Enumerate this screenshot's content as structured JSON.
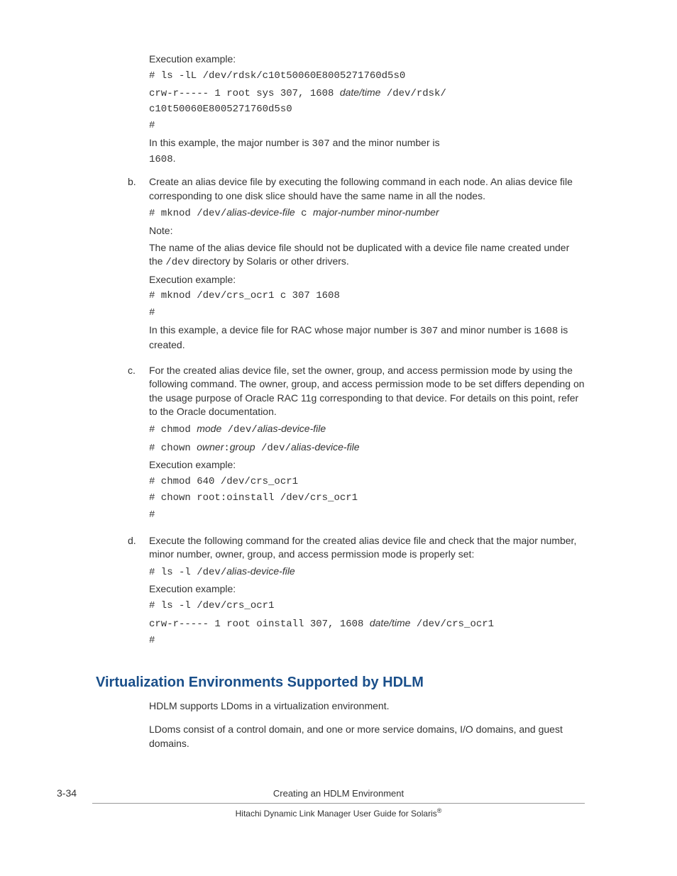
{
  "a": {
    "exec_label": "Execution example:",
    "cmd1": "# ls -lL /dev/rdsk/c10t50060E8005271760d5s0",
    "out1a": "crw-r----- 1 root sys 307, 1608 ",
    "out1b_dt": "date/time",
    "out1c": " /dev/rdsk/",
    "out1d": "c10t50060E8005271760d5s0",
    "prompt": "#",
    "summary_a": "In this example, the major number is ",
    "summary_major": "307",
    "summary_b": " and the minor number is ",
    "summary_minor": "1608",
    "summary_dot": "."
  },
  "b": {
    "marker": "b.",
    "para": "Create an alias device file by executing the following command in each node. An alias device file corresponding to one disk slice should have the same name in all the nodes.",
    "cmd_prefix": "# mknod ",
    "cmd_dev": "/dev/",
    "cmd_alias": "alias-device-file",
    "cmd_c": " c ",
    "cmd_major": "major-number",
    "sp": " ",
    "cmd_minor": "minor-number",
    "note_label": "Note:",
    "note_a": "The name of the alias device file should not be duplicated with a device file name created under the ",
    "note_code": "/dev",
    "note_b": " directory by Solaris or other drivers.",
    "exec_label": "Execution example:",
    "ex1": "# mknod /dev/crs_ocr1 c 307 1608",
    "prompt": "#",
    "summary_a": "In this example, a device file for RAC whose major number is ",
    "summary_major": "307",
    "summary_b": " and minor number is ",
    "summary_minor": "1608",
    "summary_c": " is created."
  },
  "c": {
    "marker": "c.",
    "para": "For the created alias device file, set the owner, group, and access permission mode by using the following command. The owner, group, and access permission mode to be set differs depending on the usage purpose of Oracle RAC 11g corresponding to that device. For details on this point, refer to the Oracle documentation.",
    "chmod_prefix": "# chmod ",
    "mode": "mode",
    "devslash": " /dev/",
    "alias": "alias-device-file",
    "chown_prefix": "# chown ",
    "owner": "owner",
    "colon": ":",
    "group": "group",
    "exec_label": "Execution example:",
    "ex1": "# chmod 640 /dev/crs_ocr1",
    "ex2": "# chown root:oinstall /dev/crs_ocr1",
    "prompt": "#"
  },
  "d": {
    "marker": "d.",
    "para": "Execute the following command for the created alias device file and check that the major number, minor number, owner, group, and access permission mode is properly set:",
    "cmd_prefix": "# ls -l ",
    "devslash": "/dev/",
    "alias": "alias-device-file",
    "exec_label": "Execution example:",
    "ex1": "# ls -l /dev/crs_ocr1",
    "out_a": "crw-r----- 1 root oinstall 307, 1608 ",
    "out_dt": "date/time",
    "out_b": " /dev/crs_ocr1",
    "prompt": "#"
  },
  "section": {
    "heading": "Virtualization Environments Supported by HDLM",
    "p1": "HDLM supports LDoms in a virtualization environment.",
    "p2": "LDoms consist of a control domain, and one or more service domains, I/O domains, and guest domains."
  },
  "footer": {
    "pagenum": "3-34",
    "center": "Creating an HDLM Environment",
    "title_a": "Hitachi Dynamic Link Manager User Guide for Solaris",
    "reg": "®"
  }
}
